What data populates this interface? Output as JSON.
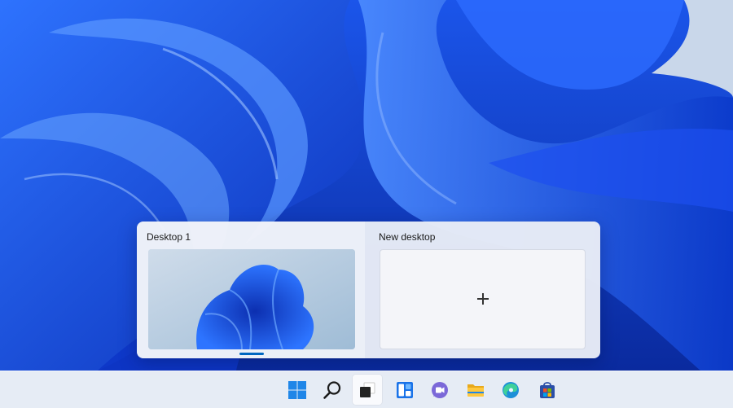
{
  "task_view": {
    "desktops": [
      {
        "label": "Desktop 1",
        "current": true
      },
      {
        "label": "New desktop",
        "current": false
      }
    ]
  },
  "taskbar": {
    "items": [
      {
        "name": "start",
        "icon": "windows-logo-icon"
      },
      {
        "name": "search",
        "icon": "search-icon"
      },
      {
        "name": "task-view",
        "icon": "task-view-icon",
        "active": true
      },
      {
        "name": "widgets",
        "icon": "widgets-icon"
      },
      {
        "name": "teams-chat",
        "icon": "chat-icon"
      },
      {
        "name": "file-explorer",
        "icon": "folder-icon"
      },
      {
        "name": "edge",
        "icon": "edge-browser-icon"
      },
      {
        "name": "store",
        "icon": "store-icon"
      }
    ]
  },
  "colors": {
    "accent": "#0067c0",
    "wallpaper_blue": "#1457f0",
    "wallpaper_sky": "#c9d7ea"
  }
}
